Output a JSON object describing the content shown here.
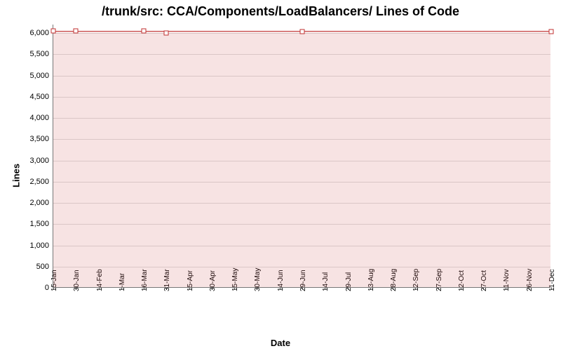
{
  "chart_data": {
    "type": "area",
    "title": "/trunk/src: CCA/Components/LoadBalancers/ Lines of Code",
    "xlabel": "Date",
    "ylabel": "Lines",
    "ylim": [
      0,
      6200
    ],
    "yticks": [
      0,
      500,
      1000,
      1500,
      2000,
      2500,
      3000,
      3500,
      4000,
      4500,
      5000,
      5500,
      6000
    ],
    "ytick_labels": [
      "0",
      "500",
      "1,000",
      "1,500",
      "2,000",
      "2,500",
      "3,000",
      "3,500",
      "4,000",
      "4,500",
      "5,000",
      "5,500",
      "6,000"
    ],
    "categories": [
      "15-Jan",
      "30-Jan",
      "14-Feb",
      "1-Mar",
      "16-Mar",
      "31-Mar",
      "15-Apr",
      "30-Apr",
      "15-May",
      "30-May",
      "14-Jun",
      "29-Jun",
      "14-Jul",
      "29-Jul",
      "13-Aug",
      "28-Aug",
      "12-Sep",
      "27-Sep",
      "12-Oct",
      "27-Oct",
      "11-Nov",
      "26-Nov",
      "11-Dec"
    ],
    "series": [
      {
        "name": "Lines of Code",
        "values": [
          6050,
          6050,
          6050,
          6050,
          6050,
          6000,
          6050,
          6050,
          6050,
          6050,
          6050,
          6030,
          6050,
          6050,
          6050,
          6050,
          6050,
          6050,
          6050,
          6050,
          6050,
          6050,
          6030
        ]
      }
    ],
    "markers_at": [
      0,
      1,
      4,
      5,
      11,
      22
    ]
  }
}
